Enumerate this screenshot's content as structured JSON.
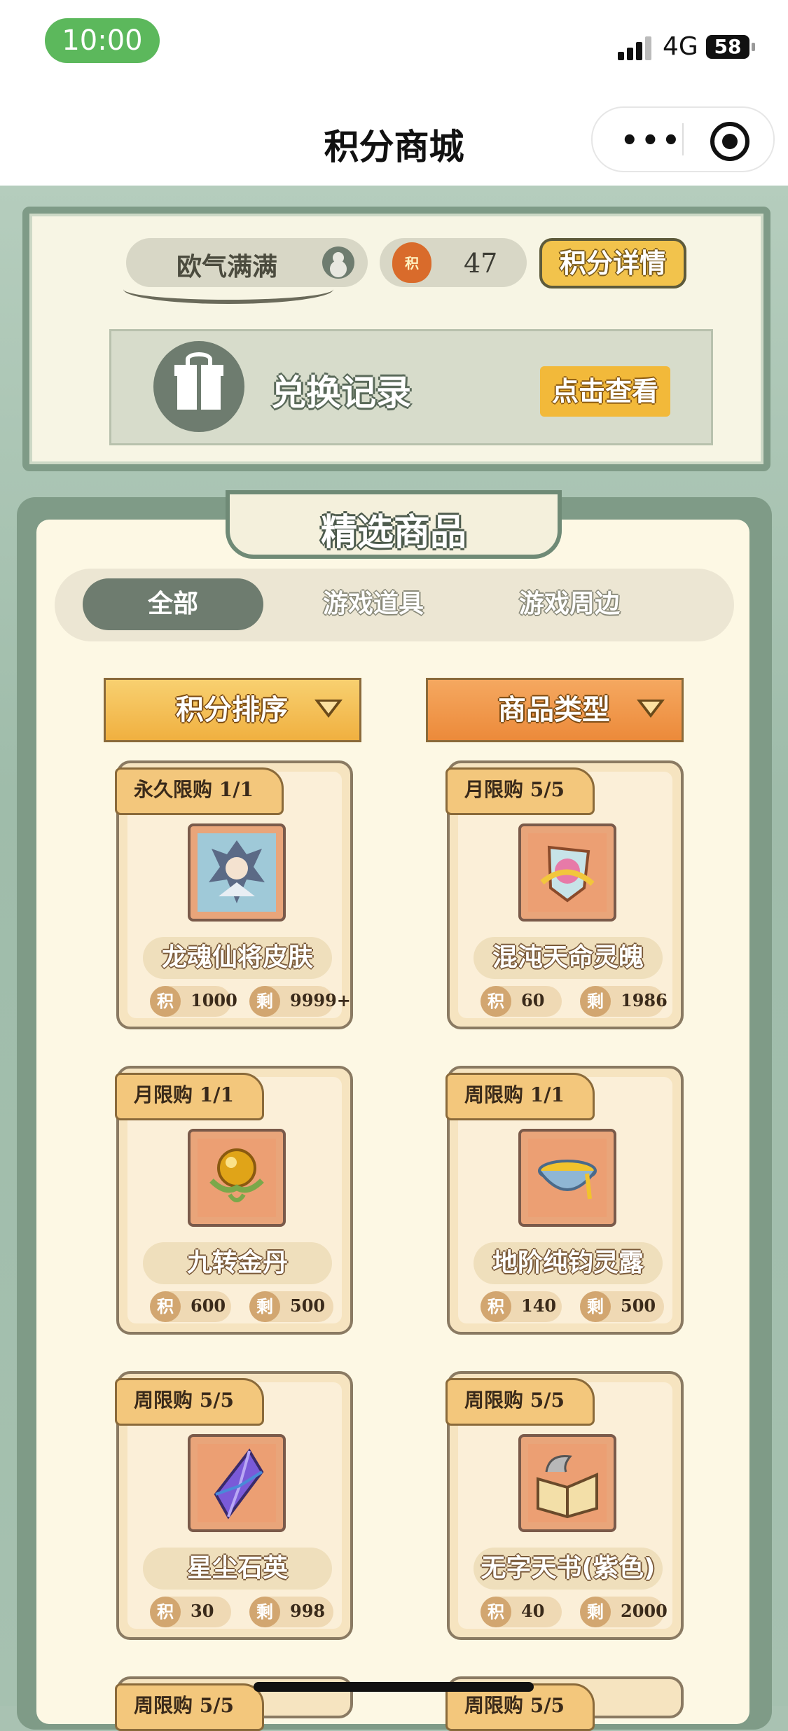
{
  "status_bar": {
    "time": "10:00",
    "network": "4G",
    "battery": "58"
  },
  "nav": {
    "title": "积分商城",
    "more_icon": "more-icon",
    "close_icon": "target-icon"
  },
  "user": {
    "name": "欧气满满",
    "points": "47",
    "points_detail_label": "积分详情",
    "bag_glyph": "积"
  },
  "records": {
    "title": "兑换记录",
    "view_label": "点击查看"
  },
  "section": {
    "title": "精选商品"
  },
  "tabs": [
    {
      "label": "全部",
      "active": true
    },
    {
      "label": "游戏道具",
      "active": false
    },
    {
      "label": "游戏周边",
      "active": false
    }
  ],
  "filters": {
    "sort_label": "积分排序",
    "type_label": "商品类型"
  },
  "stat_labels": {
    "cost": "积",
    "remain": "剩"
  },
  "items": [
    {
      "limit": "永久限购 1/1",
      "name": "龙魂仙将皮肤",
      "cost": "1000",
      "remain": "9999+",
      "icon": "dragon-warrior-skin-icon"
    },
    {
      "limit": "月限购 5/5",
      "name": "混沌天命灵魄",
      "cost": "60",
      "remain": "1986",
      "icon": "chaos-soul-icon"
    },
    {
      "limit": "月限购 1/1",
      "name": "九转金丹",
      "cost": "600",
      "remain": "500",
      "icon": "golden-pill-icon"
    },
    {
      "limit": "周限购 1/1",
      "name": "地阶纯钧灵露",
      "cost": "140",
      "remain": "500",
      "icon": "spirit-dew-bowl-icon"
    },
    {
      "limit": "周限购 5/5",
      "name": "星尘石英",
      "cost": "30",
      "remain": "998",
      "icon": "stardust-crystal-icon"
    },
    {
      "limit": "周限购 5/5",
      "name": "无字天书(紫色)",
      "cost": "40",
      "remain": "2000",
      "icon": "heavenly-book-icon"
    }
  ],
  "partial_items": [
    {
      "limit": "周限购 5/5"
    },
    {
      "limit": "周限购 5/5"
    }
  ],
  "colors": {
    "status_time": "#5cb85c",
    "frame": "#7f9b87",
    "button_gold": "#f2c34c",
    "card_bg": "#f6e4c0"
  }
}
